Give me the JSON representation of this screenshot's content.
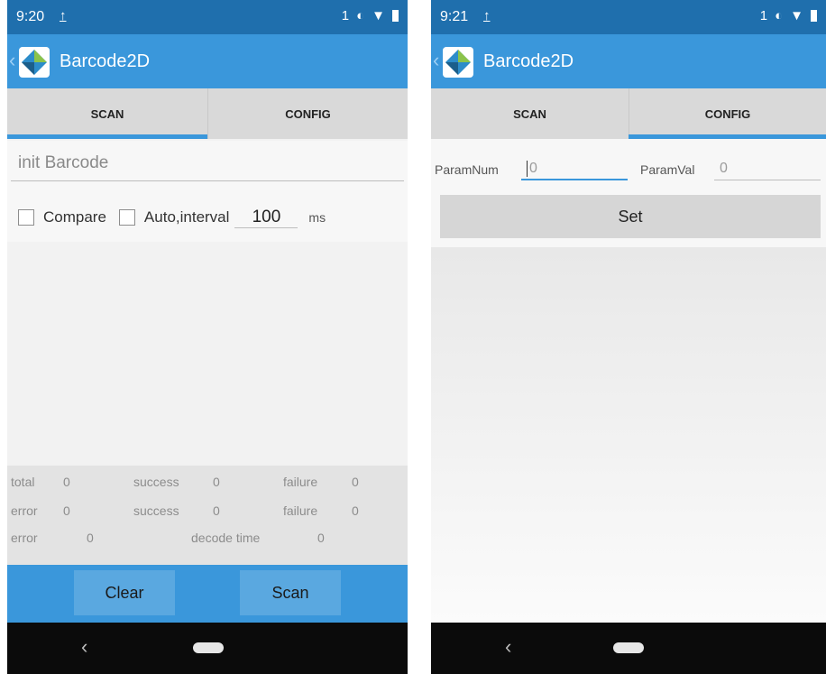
{
  "left_phone": {
    "status": {
      "time": "9:20",
      "notification": "1"
    },
    "app_title": "Barcode2D",
    "tabs": [
      {
        "label": "SCAN",
        "active": true
      },
      {
        "label": "CONFIG",
        "active": false
      }
    ],
    "barcode_placeholder": "init Barcode",
    "compare_label": "Compare",
    "auto_label": "Auto,interval",
    "interval_value": "100",
    "interval_unit": "ms",
    "stats": {
      "row1": {
        "total_label": "total",
        "total_value": "0",
        "success_label": "success",
        "success_value": "0",
        "failure_label": "failure",
        "failure_value": "0"
      },
      "row2": {
        "error_label": "error",
        "error_value": "0",
        "success_label": "success",
        "success_value": "0",
        "failure_label": "failure",
        "failure_value": "0"
      },
      "row3": {
        "error_label": "error",
        "error_value": "0",
        "decode_label": "decode time",
        "decode_value": "0"
      }
    },
    "clear_label": "Clear",
    "scan_label": "Scan"
  },
  "right_phone": {
    "status": {
      "time": "9:21",
      "notification": "1"
    },
    "app_title": "Barcode2D",
    "tabs": [
      {
        "label": "SCAN",
        "active": false
      },
      {
        "label": "CONFIG",
        "active": true
      }
    ],
    "param_num_label": "ParamNum",
    "param_num_value": "0",
    "param_val_label": "ParamVal",
    "param_val_value": "0",
    "set_label": "Set"
  },
  "colors": {
    "status_bar": "#1f6fad",
    "app_bar": "#3a97db",
    "accent": "#3a97db",
    "nav_bar": "#0b0b0b"
  },
  "icons": [
    "upload-icon",
    "vibrate-icon",
    "wifi-icon",
    "battery-icon",
    "app-logo-icon",
    "back-caret-icon",
    "nav-back-icon",
    "nav-home-icon"
  ]
}
